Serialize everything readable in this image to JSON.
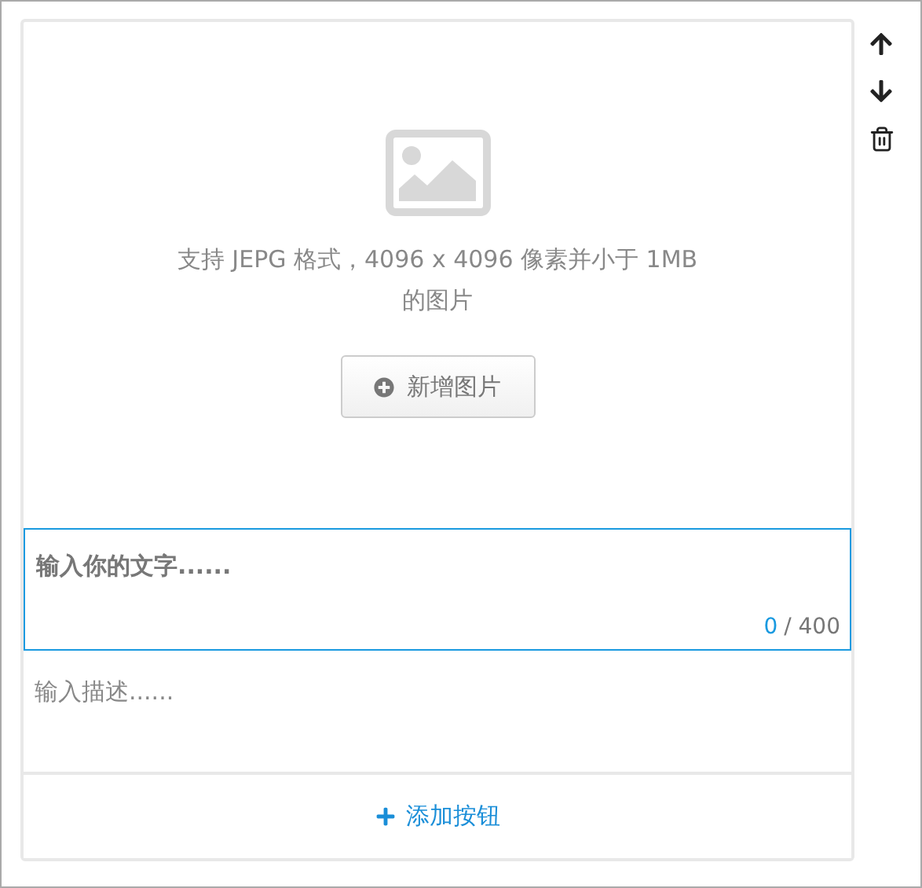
{
  "image_upload": {
    "hint": "支持 JEPG 格式，4096 x 4096 像素并小于 1MB 的图片",
    "button": "新增图片"
  },
  "title_field": {
    "placeholder": "输入你的文字......",
    "count": "0",
    "limit": "/ 400",
    "focused": true
  },
  "description_field": {
    "placeholder": "输入描述......"
  },
  "add_button": {
    "label": "添加按钮"
  },
  "side_actions": [
    {
      "kind": "up"
    },
    {
      "kind": "down"
    },
    {
      "kind": "delete"
    }
  ]
}
